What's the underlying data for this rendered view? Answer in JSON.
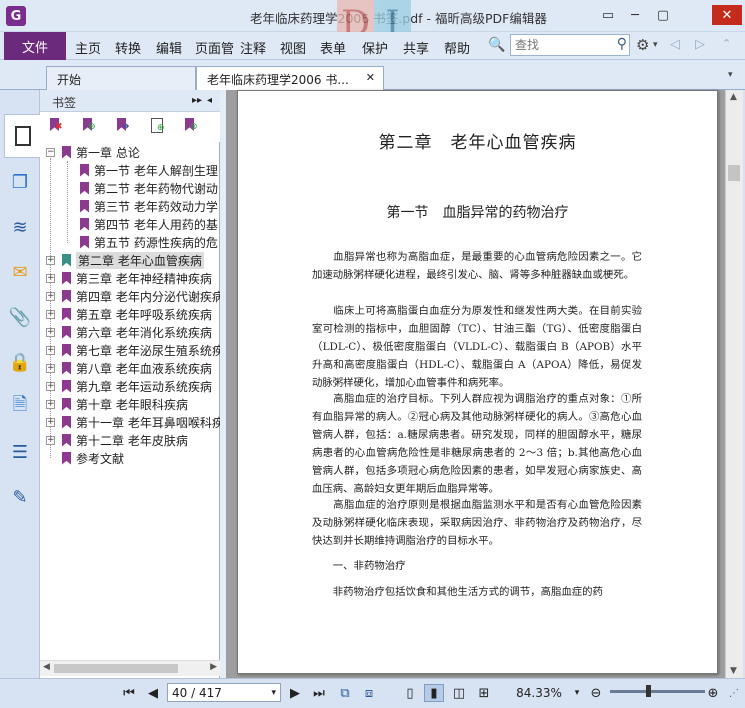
{
  "window": {
    "title": "老年临床药理学2006 书签.pdf - 福昕高级PDF编辑器",
    "logo_letter": "G",
    "watermark_left": "D",
    "watermark_right": "I"
  },
  "menu": {
    "file": "文件",
    "items": [
      "主页",
      "转换",
      "编辑",
      "页面管",
      "注释",
      "视图",
      "表单",
      "保护",
      "共享",
      "帮助"
    ]
  },
  "search": {
    "placeholder": "查找"
  },
  "tabs": [
    {
      "label": "开始"
    },
    {
      "label": "老年临床药理学2006 书..."
    }
  ],
  "bookmarks": {
    "title": "书签",
    "items": [
      {
        "label": "第一章 总论",
        "level": 0,
        "expanded": true
      },
      {
        "label": "第一节 老年人解剖生理",
        "level": 1
      },
      {
        "label": "第二节 老年药物代谢动",
        "level": 1
      },
      {
        "label": "第三节 老年药效动力学",
        "level": 1
      },
      {
        "label": "第四节 老年人用药的基",
        "level": 1
      },
      {
        "label": "第五节 药源性疾病的危",
        "level": 1
      },
      {
        "label": "第二章 老年心血管疾病",
        "level": 0,
        "selected": true
      },
      {
        "label": "第三章 老年神经精神疾病",
        "level": 0
      },
      {
        "label": "第四章 老年内分泌代谢疾病",
        "level": 0
      },
      {
        "label": "第五章 老年呼吸系统疾病",
        "level": 0
      },
      {
        "label": "第六章 老年消化系统疾病",
        "level": 0
      },
      {
        "label": "第七章 老年泌尿生殖系统疾病",
        "level": 0
      },
      {
        "label": "第八章 老年血液系统疾病",
        "level": 0
      },
      {
        "label": "第九章 老年运动系统疾病",
        "level": 0
      },
      {
        "label": "第十章 老年眼科疾病",
        "level": 0
      },
      {
        "label": "第十一章 老年耳鼻咽喉科疾病",
        "level": 0
      },
      {
        "label": "第十二章 老年皮肤病",
        "level": 0
      },
      {
        "label": "参考文献",
        "level": 0
      }
    ]
  },
  "document": {
    "chapter": "第二章　老年心血管疾病",
    "section": "第一节　血脂异常的药物治疗",
    "paragraphs": [
      "　　血脂异常也称为高脂血症，是最重要的心血管病危险因素之一。它加速动脉粥样硬化进程，最终引发心、脑、肾等多种脏器缺血或梗死。",
      "　　临床上可将高脂蛋白血症分为原发性和继发性两大类。在目前实验室可检测的指标中，血胆固醇（TC）、甘油三酯（TG）、低密度脂蛋白（LDL-C）、极低密度脂蛋白（VLDL-C）、载脂蛋白 B（APOB）水平升高和高密度脂蛋白（HDL-C）、载脂蛋白 A（APOA）降低，易促发动脉粥样硬化，增加心血管事件和病死率。",
      "　　高脂血症的治疗目标。下列人群应视为调脂治疗的重点对象：①所有血脂异常的病人。②冠心病及其他动脉粥样硬化的病人。③高危心血管病人群，包括：a.糖尿病患者。研究发现，同样的胆固醇水平，糖尿病患者的心血管病危险性是非糖尿病患者的 2～3 倍；b.其他高危心血管病人群，包括多项冠心病危险因素的患者，如早发冠心病家族史、高血压病、高龄妇女更年期后血脂异常等。",
      "　　高脂血症的治疗原则是根据血脂监测水平和是否有心血管危险因素及动脉粥样硬化临床表现，采取病因治疗、非药物治疗及药物治疗，尽快达到并长期维持调脂治疗的目标水平。",
      "　　一、非药物治疗",
      "　　非药物治疗包括饮食和其他生活方式的调节，高脂血症的药"
    ]
  },
  "status": {
    "page": "40 / 417",
    "zoom": "84.33%"
  },
  "colors": {
    "brand": "#6b2a7c",
    "flag": "#8b3a8f",
    "flag_selected": "#3a8f86"
  }
}
